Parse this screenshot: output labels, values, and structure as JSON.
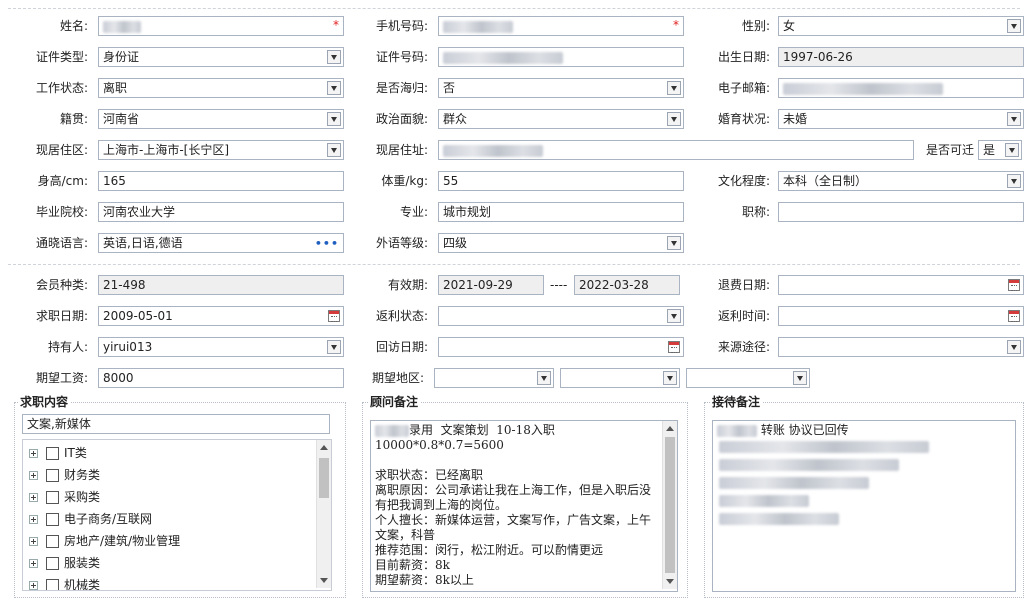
{
  "section1": {
    "name": {
      "label": "姓名:"
    },
    "phone": {
      "label": "手机号码:"
    },
    "gender": {
      "label": "性别:",
      "value": "女"
    },
    "id_type": {
      "label": "证件类型:",
      "value": "身份证"
    },
    "id_number": {
      "label": "证件号码:"
    },
    "birth_date": {
      "label": "出生日期:",
      "value": "1997-06-26"
    },
    "work_status": {
      "label": "工作状态:",
      "value": "离职"
    },
    "overseas_return": {
      "label": "是否海归:",
      "value": "否"
    },
    "email": {
      "label": "电子邮箱:"
    },
    "native_place": {
      "label": "籍贯:",
      "value": "河南省"
    },
    "political_status": {
      "label": "政治面貌:",
      "value": "群众"
    },
    "marital_status": {
      "label": "婚育状况:",
      "value": "未婚"
    },
    "residence_area": {
      "label": "现居住区:",
      "value": "上海市-上海市-[长宁区]"
    },
    "residence_address": {
      "label": "现居住址:"
    },
    "relocatable": {
      "label": "是否可迁",
      "value": "是"
    },
    "height": {
      "label": "身高/cm:",
      "value": "165"
    },
    "weight": {
      "label": "体重/kg:",
      "value": "55"
    },
    "education": {
      "label": "文化程度:",
      "value": "本科（全日制）"
    },
    "school": {
      "label": "毕业院校:",
      "value": "河南农业大学"
    },
    "major": {
      "label": "专业:",
      "value": "城市规划"
    },
    "title": {
      "label": "职称:",
      "value": ""
    },
    "languages": {
      "label": "通晓语言:",
      "value": "英语,日语,德语",
      "more": "•••"
    },
    "foreign_level": {
      "label": "外语等级:",
      "value": "四级"
    },
    "required_mark": "*"
  },
  "section2": {
    "member_type": {
      "label": "会员种类:",
      "value": "21-498"
    },
    "validity": {
      "label": "有效期:",
      "start": "2021-09-29",
      "sep": "----",
      "end": "2022-03-28"
    },
    "refund_date": {
      "label": "退费日期:",
      "value": ""
    },
    "job_date": {
      "label": "求职日期:",
      "value": "2009-05-01"
    },
    "rebate_status": {
      "label": "返利状态:",
      "value": ""
    },
    "rebate_time": {
      "label": "返利时间:",
      "value": ""
    },
    "holder": {
      "label": "持有人:",
      "value": "yirui013"
    },
    "revisit_date": {
      "label": "回访日期:",
      "value": ""
    },
    "source": {
      "label": "来源途径:",
      "value": ""
    },
    "expected_salary": {
      "label": "期望工资:",
      "value": "8000"
    },
    "expected_area": {
      "label": "期望地区:"
    }
  },
  "job_content": {
    "legend": "求职内容",
    "value": "文案,新媒体",
    "categories": [
      "IT类",
      "财务类",
      "采购类",
      "电子商务/互联网",
      "房地产/建筑/物业管理",
      "服装类",
      "机械类"
    ]
  },
  "advisor_notes": {
    "legend": "顾问备注",
    "lines": [
      "录用  文案策划  10-18入职",
      "10000*0.8*0.7=5600",
      "",
      "求职状态：已经离职",
      "离职原因：公司承诺让我在上海工作，但是入职后没",
      "有把我调到上海的岗位。",
      "个人擅长：新媒体运营，文案写作，广告文案，上午",
      "文案，科普",
      "推荐范围：闵行，松江附近。可以酌情更远",
      "目前薪资：8k",
      "期望薪资：8k以上"
    ]
  },
  "reception_notes": {
    "legend": "接待备注",
    "line1": "转账 协议已回传"
  },
  "colors": {
    "border": "#a9b3c1",
    "readonly_bg": "#efefef",
    "required": "#e02020",
    "link_dots": "#1f5fbf"
  },
  "icons": {
    "dropdown": "chevron-down-icon",
    "calendar": "calendar-icon",
    "expand": "plus-icon",
    "more": "ellipsis-icon"
  }
}
